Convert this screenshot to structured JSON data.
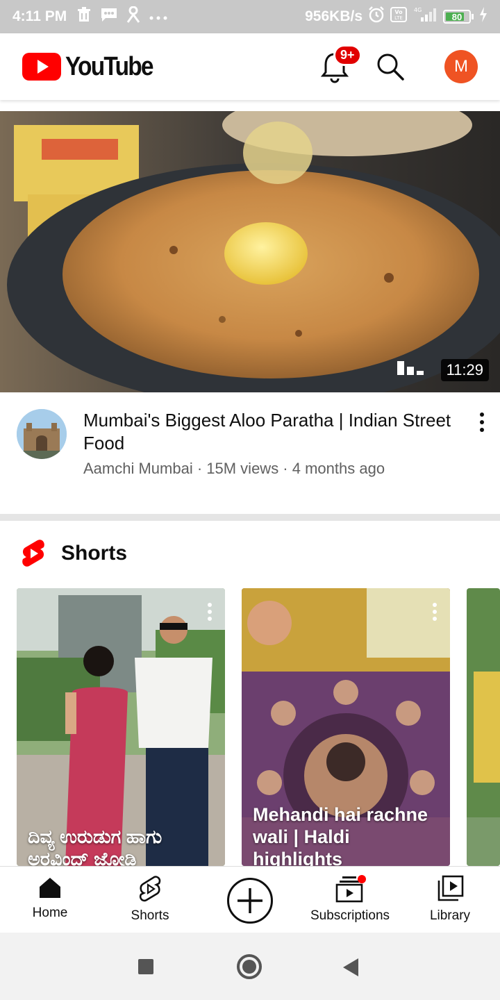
{
  "status_bar": {
    "time": "4:11 PM",
    "speed": "956KB/s",
    "network": "4G",
    "volte": "Vo LTE",
    "battery": "80"
  },
  "app_bar": {
    "logo_text": "YouTube",
    "notification_badge": "9+",
    "avatar_letter": "M"
  },
  "video": {
    "duration": "11:29",
    "title": "Mumbai's Biggest Aloo Paratha | Indian Street Food",
    "channel": "Aamchi Mumbai",
    "views": "15M views",
    "age": "4 months ago",
    "meta_line": "Aamchi Mumbai · 15M views · 4 months ago"
  },
  "shorts": {
    "heading": "Shorts",
    "items": [
      {
        "title": "ದಿವ್ಯ ಉರುಡುಗ ಹಾಗು ಅರವಿಂದ್ ಜೋಡಿ"
      },
      {
        "title": "Mehandi hai rachne wali | Haldi highlights"
      }
    ]
  },
  "bottom_nav": {
    "home": "Home",
    "shorts": "Shorts",
    "subscriptions": "Subscriptions",
    "library": "Library"
  },
  "colors": {
    "brand_red": "#ff0000",
    "avatar": "#ef5323",
    "status_bar": "#c8c8c8",
    "secondary_text": "#606060"
  }
}
